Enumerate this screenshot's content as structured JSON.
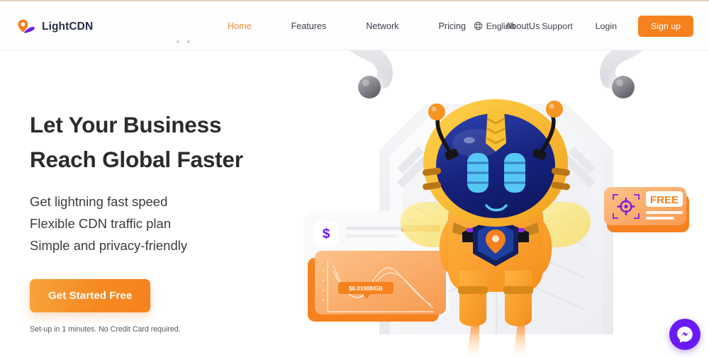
{
  "brand": {
    "name": "LightCDN",
    "logo_icon": "location-pin-icon",
    "accent": "#F5821F",
    "purple": "#6A1BF5"
  },
  "header": {
    "nav": [
      {
        "label": "Home",
        "active": true
      },
      {
        "label": "Features",
        "active": false
      },
      {
        "label": "Network",
        "active": false
      },
      {
        "label": "Pricing",
        "active": false
      },
      {
        "label": "AboutUs",
        "active": false
      }
    ],
    "language": {
      "label": "English",
      "icon": "globe-icon"
    },
    "support_label": "Support",
    "login_label": "Login",
    "signup_label": "Sign up"
  },
  "hero": {
    "title_line1": "Let Your Business",
    "title_line2": "Reach Global Faster",
    "sub_line1": "Get lightning fast speed",
    "sub_line2": "Flexible CDN traffic plan",
    "sub_line3": "Simple and privacy-friendly",
    "cta_label": "Get Started Free",
    "fine_print": "Set-up in 1 minutes. No Credit Card required."
  },
  "illustration": {
    "price_badge": "$0.01008/GB",
    "free_badge": "FREE",
    "dollar_icon": "dollar-sign-icon",
    "target_icon": "crosshair-target-icon",
    "mascot": "bee-robot-mascot"
  },
  "widgets": {
    "messenger_icon": "messenger-chat-icon"
  }
}
